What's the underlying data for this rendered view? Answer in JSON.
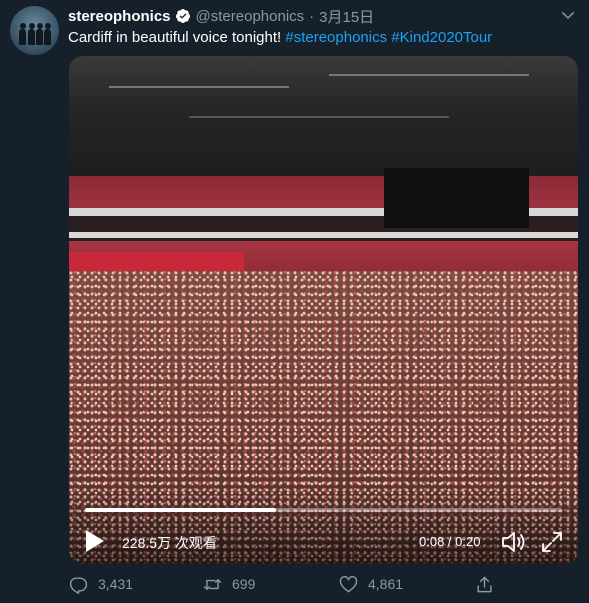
{
  "account": {
    "name": "stereophonics",
    "handle": "@stereophonics",
    "separator": "·",
    "date": "3月15日",
    "verified": true
  },
  "tweet": {
    "text_prefix": "Cardiff in beautiful voice tonight! ",
    "hashtags": [
      "#stereophonics",
      "#Kind2020Tour"
    ]
  },
  "video": {
    "views": "228.5万 次观看",
    "time": "0:08 / 0:20",
    "progress": 0.4,
    "controls": [
      "play-icon",
      "volume-icon",
      "fullscreen-icon"
    ]
  },
  "actions": {
    "reply_count": "3,431",
    "retweet_count": "699",
    "like_count": "4,861"
  },
  "colors": {
    "background": "#15202b",
    "accent": "#1da1f2",
    "secondary_text": "#8899a6"
  }
}
